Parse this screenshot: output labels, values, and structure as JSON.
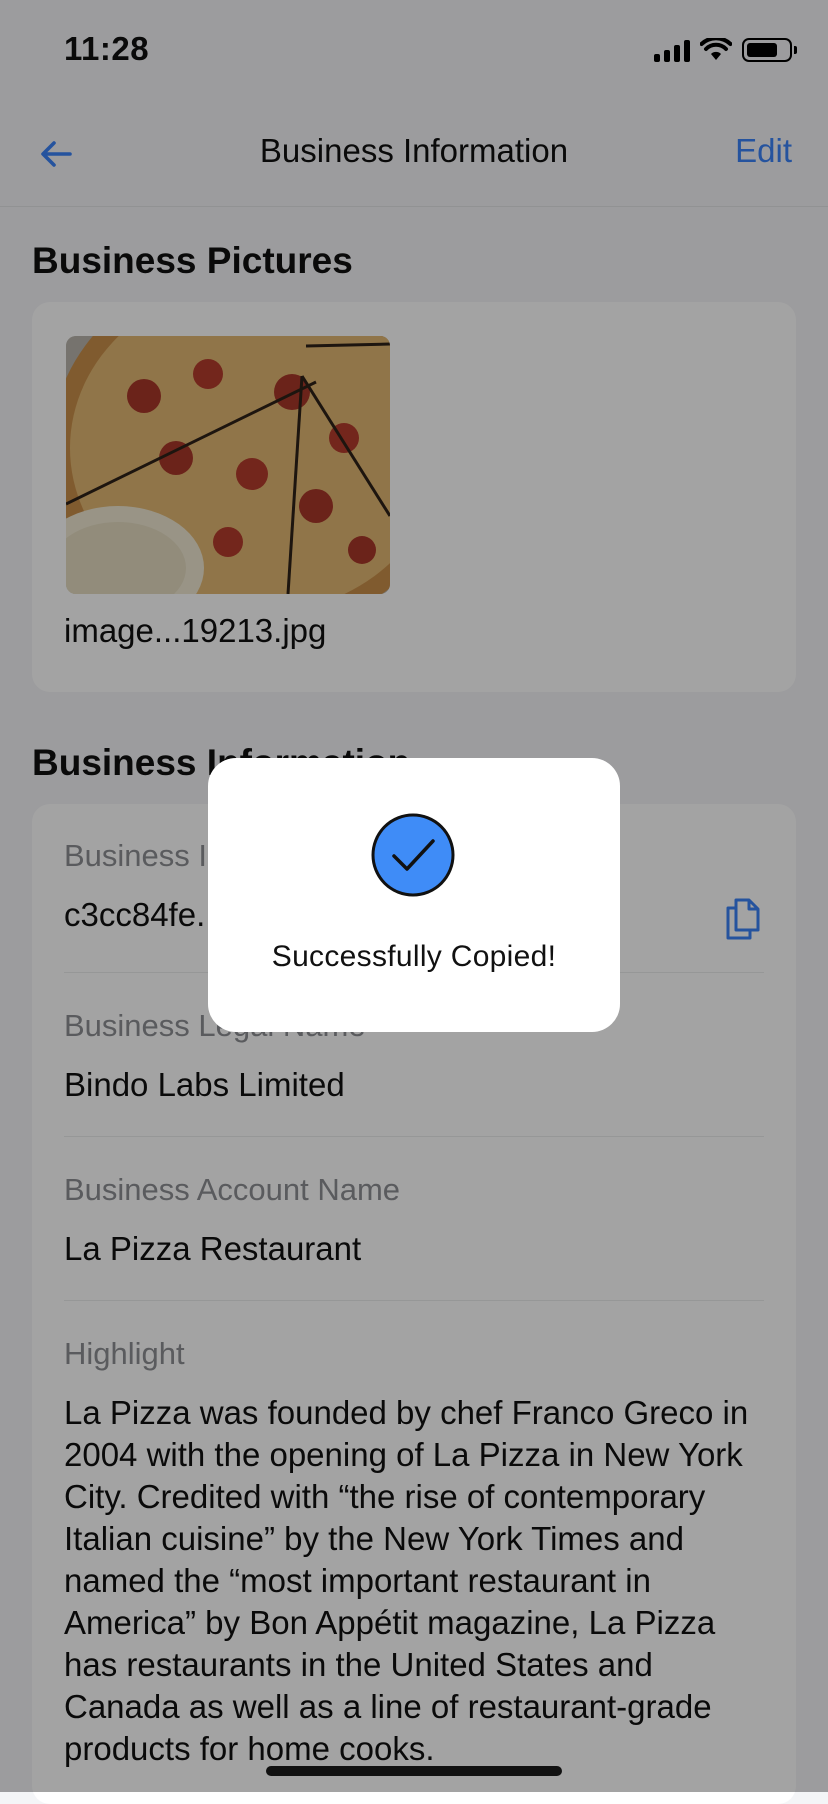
{
  "status": {
    "time": "11:28"
  },
  "nav": {
    "title": "Business Information",
    "edit_label": "Edit"
  },
  "pictures": {
    "section_title": "Business Pictures",
    "image_caption": "image...19213.jpg"
  },
  "info": {
    "section_title": "Business Information",
    "fields": [
      {
        "label": "Business ID",
        "value": "c3cc84fe...a..."
      },
      {
        "label": "Business Legal Name",
        "value": "Bindo Labs Limited"
      },
      {
        "label": "Business Account Name",
        "value": "La Pizza Restaurant"
      },
      {
        "label": "Highlight",
        "value": "La Pizza was founded by chef Franco Greco in 2004 with the opening of La Pizza in New York City. Credited with “the rise of contemporary Italian cuisine” by the New York Times and named the “most important restaurant in America” by Bon Appétit magazine, La Pizza has restaurants in the United States and Canada as well as a line of restaurant-grade products for home cooks."
      }
    ]
  },
  "toast": {
    "message": "Successfully Copied!"
  },
  "colors": {
    "accent": "#3a82f7",
    "toast_icon": "#3f8cf7"
  }
}
